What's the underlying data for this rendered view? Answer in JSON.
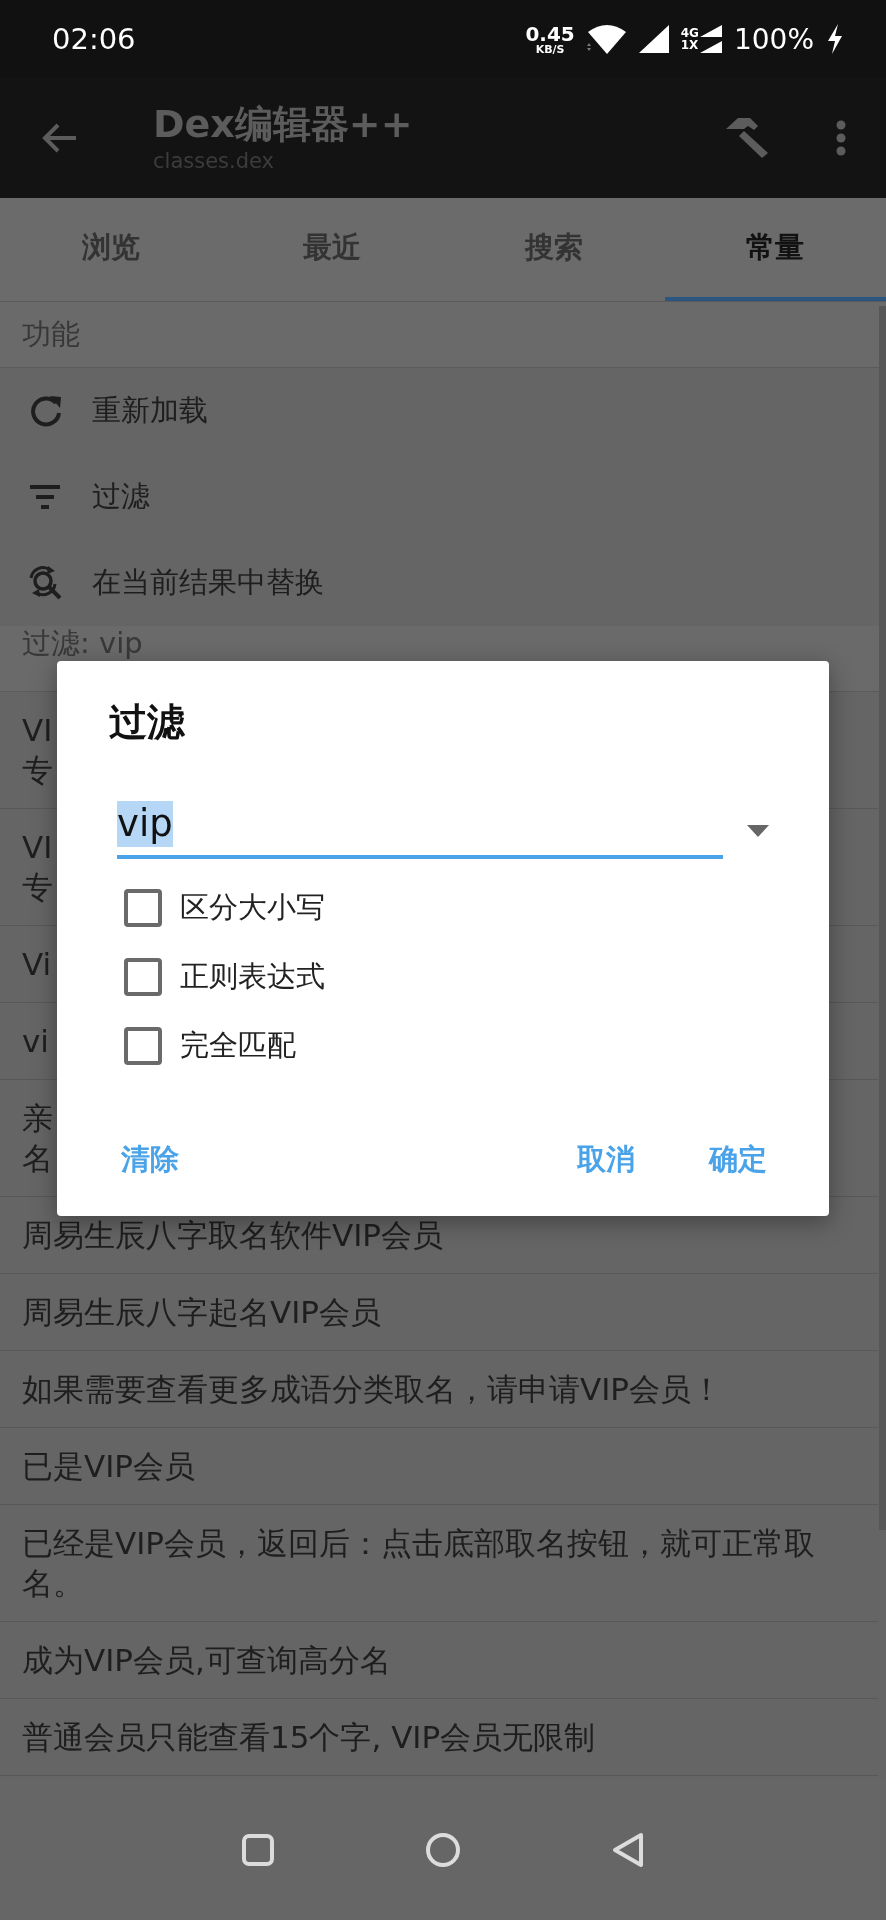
{
  "status_bar": {
    "time": "02:06",
    "net_speed": "0.45",
    "net_unit": "KB/S",
    "network_top": "4G",
    "network_bottom": "1X",
    "battery": "100%"
  },
  "app_bar": {
    "title": "Dex编辑器++",
    "subtitle": "classes.dex"
  },
  "tabs": [
    {
      "label": "浏览",
      "selected": false
    },
    {
      "label": "最近",
      "selected": false
    },
    {
      "label": "搜索",
      "selected": false
    },
    {
      "label": "常量",
      "selected": true
    }
  ],
  "functions": {
    "header": "功能",
    "items": [
      {
        "kind": "reload",
        "label": "重新加载"
      },
      {
        "kind": "filter",
        "label": "过滤"
      },
      {
        "kind": "replace",
        "label": "在当前结果中替换"
      }
    ]
  },
  "results": {
    "header": "过滤: vip",
    "rows": [
      {
        "lines": [
          "VI",
          "专"
        ]
      },
      {
        "lines": [
          "VI",
          "专"
        ]
      },
      {
        "lines": [
          "Vi"
        ]
      },
      {
        "lines": [
          "vi"
        ]
      },
      {
        "lines": [
          "亲",
          "名"
        ]
      },
      {
        "lines": [
          "周易生辰八字取名软件VIP会员"
        ]
      },
      {
        "lines": [
          "周易生辰八字起名VIP会员"
        ]
      },
      {
        "lines": [
          "如果需要查看更多成语分类取名，请申请VIP会员！"
        ]
      },
      {
        "lines": [
          "已是VIP会员"
        ]
      },
      {
        "lines": [
          "已经是VIP会员，返回后：点击底部取名按钮，就可正常取名。"
        ]
      },
      {
        "lines": [
          "成为VIP会员,可查询高分名"
        ]
      },
      {
        "lines": [
          "普通会员只能查看15个字, VIP会员无限制"
        ]
      }
    ]
  },
  "dialog": {
    "title": "过滤",
    "input": {
      "value": "vip",
      "text_selected": true
    },
    "options": [
      {
        "label": "区分大小写",
        "checked": false
      },
      {
        "label": "正则表达式",
        "checked": false
      },
      {
        "label": "完全匹配",
        "checked": false
      }
    ],
    "buttons": [
      {
        "label": "清除",
        "kind": "left"
      },
      {
        "label": "取消",
        "kind": "right"
      },
      {
        "label": "确定",
        "kind": "right"
      }
    ]
  }
}
